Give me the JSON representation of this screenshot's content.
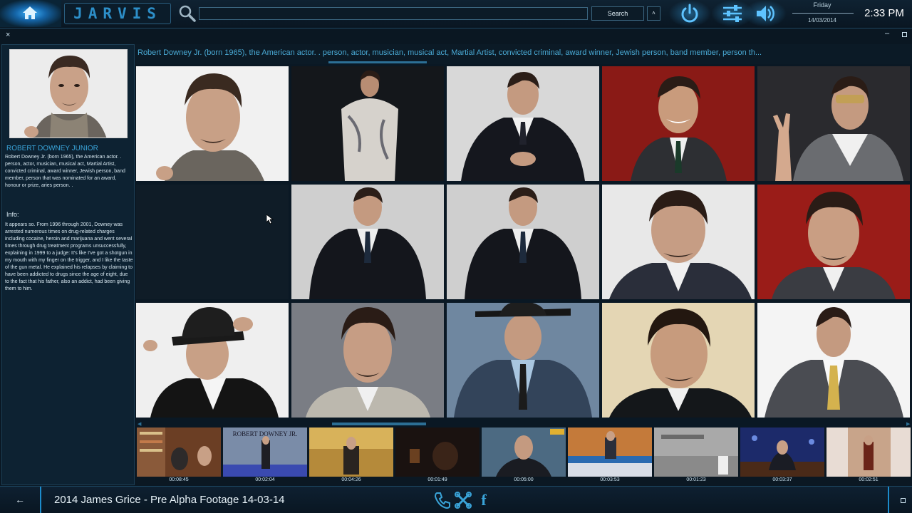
{
  "topbar": {
    "brand": "JARVIS",
    "search_placeholder": "",
    "search_button": "Search",
    "caret": "˄",
    "day": "Friday",
    "date": "14/03/2014",
    "time": "2:33 PM"
  },
  "window": {
    "close": "×",
    "minimize": "–"
  },
  "profile": {
    "name": "ROBERT DOWNEY JUNIOR",
    "description": "Robert Downey Jr. (born 1965), the American actor. . person, actor, musician, musical act, Martial Artist, convicted criminal, award winner, Jewish person, band member, person that was nominated for an award, honour or prize, aries person. .",
    "info_heading": "Info:",
    "info_text": "It appears so. From 1996 through 2001, Downey was arrested numerous times on drug-related charges including cocaine, heroin and marijuana and went several times through drug treatment programs unsuccessfully, explaining in 1999 to a judge: It's like I've got a shotgun in my mouth with my finger on the trigger, and I like the taste of the gun metal. He explained his relapses by claiming to have been addicted to drugs since the age of eight, due to the fact that his father, also an addict, had been giving them to him."
  },
  "tags": "Robert Downey Jr. (born 1965), the American actor. . person, actor, musician, musical act, Martial Artist, convicted criminal, award winner, Jewish person, band member, person th...",
  "videos": [
    {
      "time": "00:08:45"
    },
    {
      "time": "00:02:04"
    },
    {
      "time": "00:04:26"
    },
    {
      "time": "00:01:49"
    },
    {
      "time": "00:05:00"
    },
    {
      "time": "00:03:53"
    },
    {
      "time": "00:01:23"
    },
    {
      "time": "00:03:37"
    },
    {
      "time": "00:02:51"
    }
  ],
  "bottombar": {
    "back": "←",
    "title": "2014 James Grice - Pre Alpha Footage 14-03-14",
    "facebook": "f"
  },
  "colors": {
    "accent": "#2d8fc9",
    "background": "#0a1824",
    "panel": "#0d2232"
  },
  "icons": [
    "home-icon",
    "search-icon",
    "power-icon",
    "sliders-icon",
    "volume-icon",
    "phone-icon",
    "x-network-icon",
    "facebook-icon"
  ]
}
